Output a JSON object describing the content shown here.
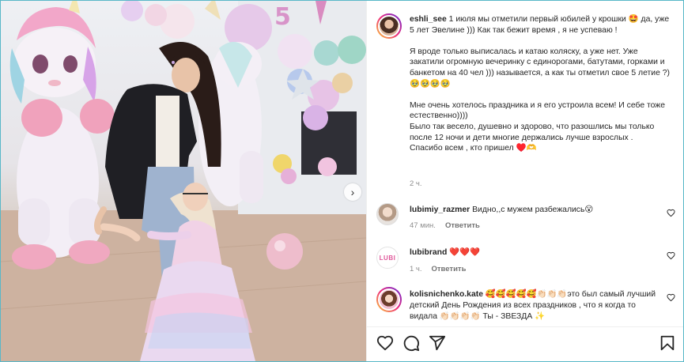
{
  "post": {
    "author": "eshli_see",
    "caption_text": " 1 июля мы отметили первый юбилей у крошки 🤩 да, уже 5 лет Эвелине ))) Как так бежит время , я не успеваю !\n\nЯ вроде только выписалась и катаю коляску, а уже нет. Уже закатили огромную вечеринку с единорогами, батутами, горками и банкетом на 40 чел ))) называется, а как ты отметил свое 5 летие ?) 🥹🥹🥹🥹\n\nМне очень хотелось праздника и я его устроила всем! И себе тоже естественно))))\nБыло так весело, душевно и здорово, что разошлись мы только после 12 ночи и дети многие держались лучше взрослых .\nСпасибо всем , кто пришел ♥️🫶",
    "time": "2 ч."
  },
  "comments": [
    {
      "user": "lubimiy_razmer",
      "text": " Видно,,с мужем разбежались😮",
      "time": "47 мин.",
      "reply": "Ответить"
    },
    {
      "user": "lubibrand",
      "text": " ❤️❤️❤️",
      "time": "1 ч.",
      "reply": "Ответить"
    },
    {
      "user": "kolisnichenko.kate",
      "text": " 🥰🥰🥰🥰🥰👏🏻👏🏻👏🏻это был самый лучший детский День Рождения из всех праздников , что я когда то видала 👏🏻👏🏻👏🏻👏🏻 Ты - ЗВЕЗДА ✨",
      "time": "",
      "reply": ""
    }
  ],
  "avatars": {
    "lubibrand_logo": "LUBI"
  },
  "icons": {
    "like": "heart-outline-icon",
    "comment": "comment-bubble-icon",
    "share": "paper-plane-icon",
    "save": "bookmark-icon",
    "next": "chevron-right-icon",
    "comment_like": "small-heart-icon"
  },
  "colors": {
    "frame_border": "#58b7c8",
    "text": "#262626",
    "muted": "#8e8e8e",
    "story_ring": "#ee2a7b"
  }
}
